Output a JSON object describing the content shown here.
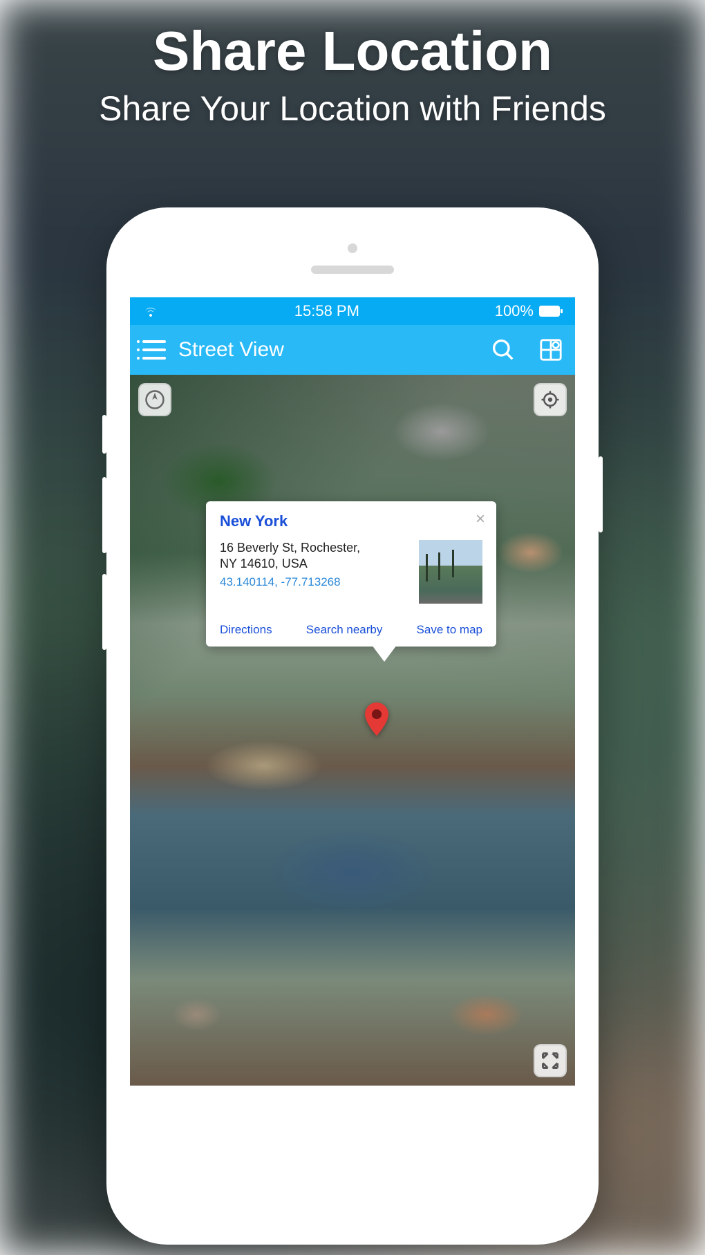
{
  "promo": {
    "title": "Share Location",
    "subtitle": "Share Your Location with Friends"
  },
  "statusBar": {
    "time": "15:58 PM",
    "battery": "100%"
  },
  "appBar": {
    "title": "Street View"
  },
  "callout": {
    "title": "New York",
    "address_line1": "16 Beverly St, Rochester,",
    "address_line2": "NY 14610, USA",
    "coords": "43.140114, -77.713268",
    "action_directions": "Directions",
    "action_search": "Search nearby",
    "action_save": "Save to map"
  }
}
